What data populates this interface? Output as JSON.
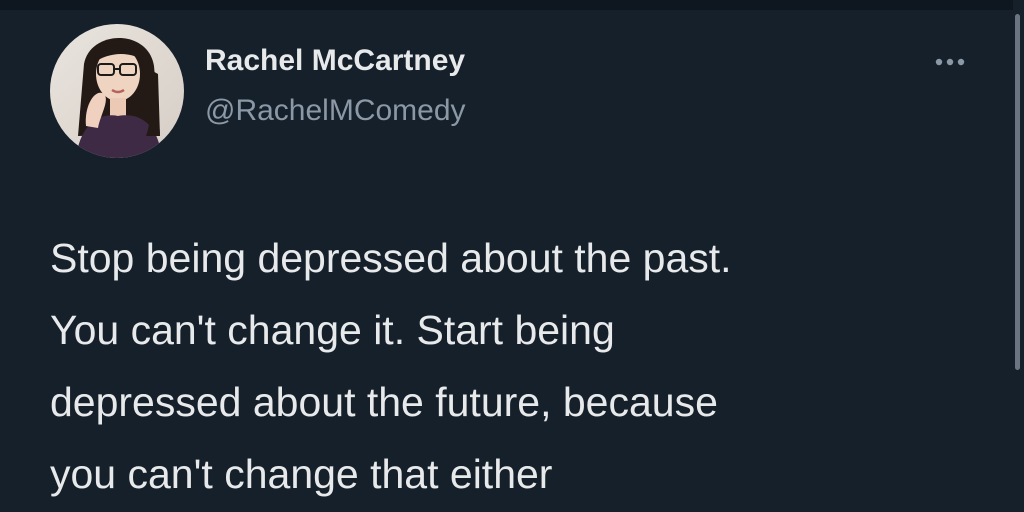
{
  "tweet": {
    "author_name": "Rachel McCartney",
    "author_handle": "@RachelMComedy",
    "text": "Stop being depressed about the past.\nYou can't change it. Start being\ndepressed about the future, because\nyou can't change that either"
  },
  "icons": {
    "more": "more-horizontal-icon"
  },
  "colors": {
    "background": "#15202b",
    "primary_text": "#e7e9ea",
    "secondary_text": "#8b98a5"
  }
}
